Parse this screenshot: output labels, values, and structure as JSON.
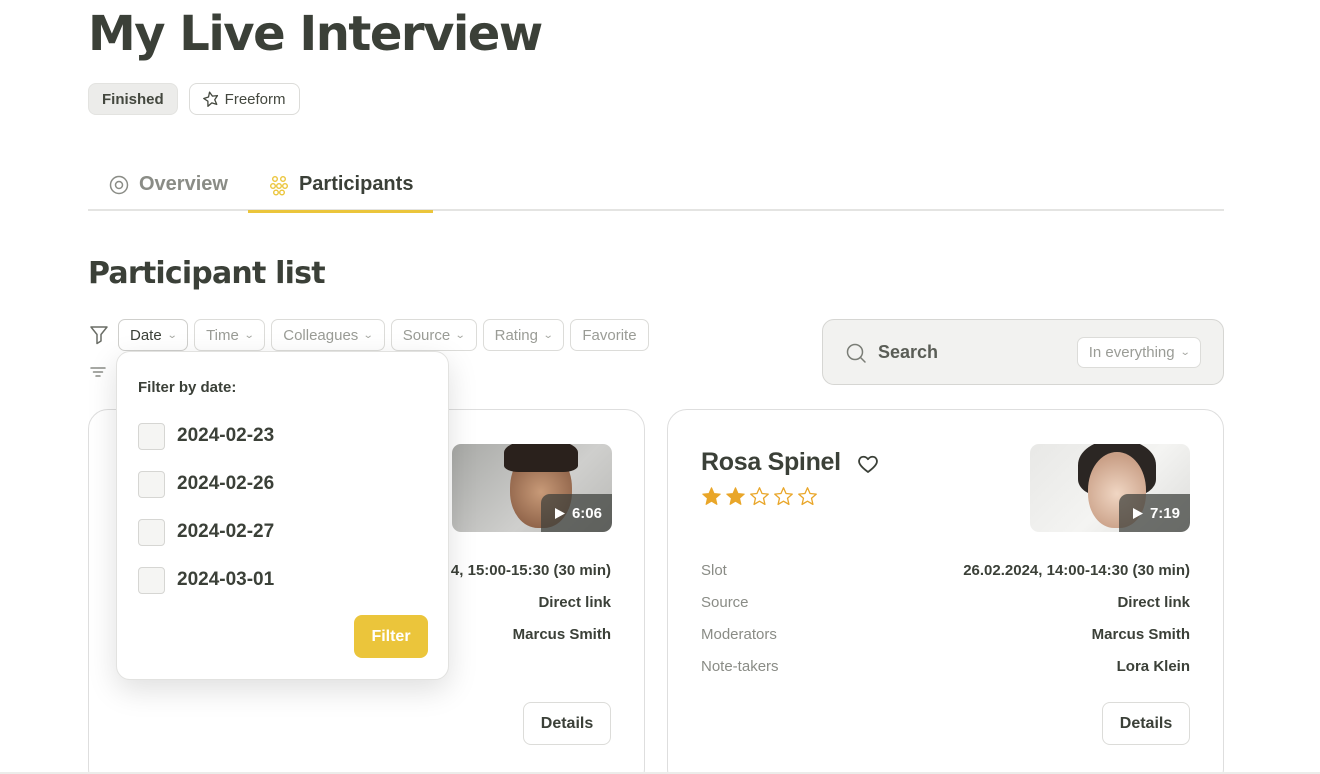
{
  "page": {
    "title": "My Live Interview"
  },
  "badges": {
    "status": "Finished",
    "type": "Freeform"
  },
  "tabs": [
    {
      "label": "Overview",
      "icon": "eye-icon",
      "active": false
    },
    {
      "label": "Participants",
      "icon": "participants-icon",
      "active": true
    }
  ],
  "section": {
    "title": "Participant list"
  },
  "filters": [
    {
      "label": "Date",
      "has_dropdown": true,
      "active": true
    },
    {
      "label": "Time",
      "has_dropdown": true,
      "active": false
    },
    {
      "label": "Colleagues",
      "has_dropdown": true,
      "active": false
    },
    {
      "label": "Source",
      "has_dropdown": true,
      "active": false
    },
    {
      "label": "Rating",
      "has_dropdown": true,
      "active": false
    },
    {
      "label": "Favorite",
      "has_dropdown": false,
      "active": false
    }
  ],
  "search": {
    "label": "Search",
    "scope": "In everything"
  },
  "date_dropdown": {
    "title": "Filter by date:",
    "options": [
      "2024-02-23",
      "2024-02-26",
      "2024-02-27",
      "2024-03-01"
    ],
    "button": "Filter"
  },
  "cards": [
    {
      "duration": "6:06",
      "slot_visible": "4, 15:00-15:30 (30 min)",
      "source": "Direct link",
      "moderators": "Marcus Smith",
      "details": "Details"
    },
    {
      "name": "Rosa Spinel",
      "rating": 2,
      "rating_max": 5,
      "duration": "7:19",
      "labels": {
        "slot": "Slot",
        "source": "Source",
        "moderators": "Moderators",
        "notetakers": "Note-takers"
      },
      "slot": "26.02.2024, 14:00-14:30 (30 min)",
      "source": "Direct link",
      "moderators": "Marcus Smith",
      "notetakers": "Lora Klein",
      "details": "Details"
    }
  ],
  "colors": {
    "accent": "#ebc53b",
    "text": "#3b4038",
    "muted": "#8a8c86"
  }
}
